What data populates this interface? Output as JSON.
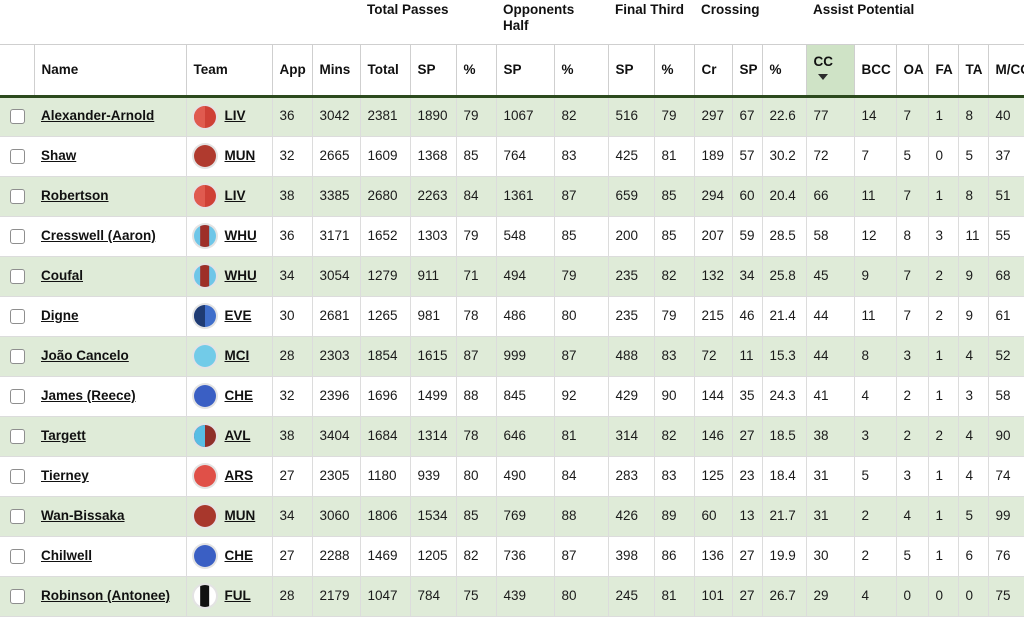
{
  "table": {
    "groups": [
      {
        "label": "",
        "span": 5,
        "blank": true
      },
      {
        "label": "Total Passes",
        "span": 3
      },
      {
        "label": "Opponents Half",
        "span": 2
      },
      {
        "label": "Final Third",
        "span": 2
      },
      {
        "label": "Crossing",
        "span": 3
      },
      {
        "label": "Assist Potential",
        "span": 6
      }
    ],
    "columns": [
      {
        "key": "check",
        "label": "",
        "name": "select-all-column"
      },
      {
        "key": "name",
        "label": "Name",
        "name": "name-column"
      },
      {
        "key": "team",
        "label": "Team",
        "name": "team-column"
      },
      {
        "key": "app",
        "label": "App",
        "name": "app-column"
      },
      {
        "key": "mins",
        "label": "Mins",
        "name": "mins-column"
      },
      {
        "key": "tp_total",
        "label": "Total",
        "name": "total-passes-total-column"
      },
      {
        "key": "tp_sp",
        "label": "SP",
        "name": "total-passes-sp-column"
      },
      {
        "key": "tp_pct",
        "label": "%",
        "name": "total-passes-pct-column"
      },
      {
        "key": "oh_sp",
        "label": "SP",
        "name": "opponents-half-sp-column"
      },
      {
        "key": "oh_pct",
        "label": "%",
        "name": "opponents-half-pct-column"
      },
      {
        "key": "ft_sp",
        "label": "SP",
        "name": "final-third-sp-column"
      },
      {
        "key": "ft_pct",
        "label": "%",
        "name": "final-third-pct-column"
      },
      {
        "key": "cr",
        "label": "Cr",
        "name": "crossing-cr-column"
      },
      {
        "key": "cr_sp",
        "label": "SP",
        "name": "crossing-sp-column"
      },
      {
        "key": "cr_pct",
        "label": "%",
        "name": "crossing-pct-column"
      },
      {
        "key": "cc",
        "label": "CC",
        "name": "assist-cc-column",
        "sorted": true,
        "sort_dir": "desc"
      },
      {
        "key": "bcc",
        "label": "BCC",
        "name": "assist-bcc-column"
      },
      {
        "key": "oa",
        "label": "OA",
        "name": "assist-oa-column"
      },
      {
        "key": "fa",
        "label": "FA",
        "name": "assist-fa-column"
      },
      {
        "key": "ta",
        "label": "TA",
        "name": "assist-ta-column"
      },
      {
        "key": "mcc",
        "label": "M/CC",
        "name": "assist-mcc-column"
      }
    ],
    "sorted_column": "CC",
    "rows": [
      {
        "name": "Alexander-Arnold",
        "team": "LIV",
        "badge": {
          "type": "split",
          "left": "#e05a4f",
          "right": "#cf4036"
        },
        "app": "36",
        "mins": "3042",
        "tp_total": "2381",
        "tp_sp": "1890",
        "tp_pct": "79",
        "oh_sp": "1067",
        "oh_pct": "82",
        "ft_sp": "516",
        "ft_pct": "79",
        "cr": "297",
        "cr_sp": "67",
        "cr_pct": "22.6",
        "cc": "77",
        "bcc": "14",
        "oa": "7",
        "fa": "1",
        "ta": "8",
        "mcc": "40"
      },
      {
        "name": "Shaw",
        "team": "MUN",
        "badge": {
          "type": "solid",
          "left": "#b03a2e",
          "right": "#b03a2e"
        },
        "app": "32",
        "mins": "2665",
        "tp_total": "1609",
        "tp_sp": "1368",
        "tp_pct": "85",
        "oh_sp": "764",
        "oh_pct": "83",
        "ft_sp": "425",
        "ft_pct": "81",
        "cr": "189",
        "cr_sp": "57",
        "cr_pct": "30.2",
        "cc": "72",
        "bcc": "7",
        "oa": "5",
        "fa": "0",
        "ta": "5",
        "mcc": "37"
      },
      {
        "name": "Robertson",
        "team": "LIV",
        "badge": {
          "type": "split",
          "left": "#e05a4f",
          "right": "#cf4036"
        },
        "app": "38",
        "mins": "3385",
        "tp_total": "2680",
        "tp_sp": "2263",
        "tp_pct": "84",
        "oh_sp": "1361",
        "oh_pct": "87",
        "ft_sp": "659",
        "ft_pct": "85",
        "cr": "294",
        "cr_sp": "60",
        "cr_pct": "20.4",
        "cc": "66",
        "bcc": "11",
        "oa": "7",
        "fa": "1",
        "ta": "8",
        "mcc": "51"
      },
      {
        "name": "Cresswell (Aaron)",
        "team": "WHU",
        "badge": {
          "type": "stripe",
          "base": "#6ec6e8",
          "stripe": "#9e2f28"
        },
        "app": "36",
        "mins": "3171",
        "tp_total": "1652",
        "tp_sp": "1303",
        "tp_pct": "79",
        "oh_sp": "548",
        "oh_pct": "85",
        "ft_sp": "200",
        "ft_pct": "85",
        "cr": "207",
        "cr_sp": "59",
        "cr_pct": "28.5",
        "cc": "58",
        "bcc": "12",
        "oa": "8",
        "fa": "3",
        "ta": "11",
        "mcc": "55"
      },
      {
        "name": "Coufal",
        "team": "WHU",
        "badge": {
          "type": "stripe",
          "base": "#6ec6e8",
          "stripe": "#9e2f28"
        },
        "app": "34",
        "mins": "3054",
        "tp_total": "1279",
        "tp_sp": "911",
        "tp_pct": "71",
        "oh_sp": "494",
        "oh_pct": "79",
        "ft_sp": "235",
        "ft_pct": "82",
        "cr": "132",
        "cr_sp": "34",
        "cr_pct": "25.8",
        "cc": "45",
        "bcc": "9",
        "oa": "7",
        "fa": "2",
        "ta": "9",
        "mcc": "68"
      },
      {
        "name": "Digne",
        "team": "EVE",
        "badge": {
          "type": "split",
          "left": "#1f3b73",
          "right": "#3f6ecb"
        },
        "app": "30",
        "mins": "2681",
        "tp_total": "1265",
        "tp_sp": "981",
        "tp_pct": "78",
        "oh_sp": "486",
        "oh_pct": "80",
        "ft_sp": "235",
        "ft_pct": "79",
        "cr": "215",
        "cr_sp": "46",
        "cr_pct": "21.4",
        "cc": "44",
        "bcc": "11",
        "oa": "7",
        "fa": "2",
        "ta": "9",
        "mcc": "61"
      },
      {
        "name": "João Cancelo",
        "team": "MCI",
        "badge": {
          "type": "solid",
          "left": "#72cbe8",
          "right": "#72cbe8"
        },
        "app": "28",
        "mins": "2303",
        "tp_total": "1854",
        "tp_sp": "1615",
        "tp_pct": "87",
        "oh_sp": "999",
        "oh_pct": "87",
        "ft_sp": "488",
        "ft_pct": "83",
        "cr": "72",
        "cr_sp": "11",
        "cr_pct": "15.3",
        "cc": "44",
        "bcc": "8",
        "oa": "3",
        "fa": "1",
        "ta": "4",
        "mcc": "52"
      },
      {
        "name": "James (Reece)",
        "team": "CHE",
        "badge": {
          "type": "solid",
          "left": "#3a5fc4",
          "right": "#3a5fc4"
        },
        "app": "32",
        "mins": "2396",
        "tp_total": "1696",
        "tp_sp": "1499",
        "tp_pct": "88",
        "oh_sp": "845",
        "oh_pct": "92",
        "ft_sp": "429",
        "ft_pct": "90",
        "cr": "144",
        "cr_sp": "35",
        "cr_pct": "24.3",
        "cc": "41",
        "bcc": "4",
        "oa": "2",
        "fa": "1",
        "ta": "3",
        "mcc": "58"
      },
      {
        "name": "Targett",
        "team": "AVL",
        "badge": {
          "type": "split",
          "left": "#58bde4",
          "right": "#8f2f2a"
        },
        "app": "38",
        "mins": "3404",
        "tp_total": "1684",
        "tp_sp": "1314",
        "tp_pct": "78",
        "oh_sp": "646",
        "oh_pct": "81",
        "ft_sp": "314",
        "ft_pct": "82",
        "cr": "146",
        "cr_sp": "27",
        "cr_pct": "18.5",
        "cc": "38",
        "bcc": "3",
        "oa": "2",
        "fa": "2",
        "ta": "4",
        "mcc": "90"
      },
      {
        "name": "Tierney",
        "team": "ARS",
        "badge": {
          "type": "solid",
          "left": "#e05048",
          "right": "#e05048"
        },
        "app": "27",
        "mins": "2305",
        "tp_total": "1180",
        "tp_sp": "939",
        "tp_pct": "80",
        "oh_sp": "490",
        "oh_pct": "84",
        "ft_sp": "283",
        "ft_pct": "83",
        "cr": "125",
        "cr_sp": "23",
        "cr_pct": "18.4",
        "cc": "31",
        "bcc": "5",
        "oa": "3",
        "fa": "1",
        "ta": "4",
        "mcc": "74"
      },
      {
        "name": "Wan-Bissaka",
        "team": "MUN",
        "badge": {
          "type": "solid",
          "left": "#a8372c",
          "right": "#a8372c"
        },
        "app": "34",
        "mins": "3060",
        "tp_total": "1806",
        "tp_sp": "1534",
        "tp_pct": "85",
        "oh_sp": "769",
        "oh_pct": "88",
        "ft_sp": "426",
        "ft_pct": "89",
        "cr": "60",
        "cr_sp": "13",
        "cr_pct": "21.7",
        "cc": "31",
        "bcc": "2",
        "oa": "4",
        "fa": "1",
        "ta": "5",
        "mcc": "99"
      },
      {
        "name": "Chilwell",
        "team": "CHE",
        "badge": {
          "type": "solid",
          "left": "#3a5fc4",
          "right": "#3a5fc4"
        },
        "app": "27",
        "mins": "2288",
        "tp_total": "1469",
        "tp_sp": "1205",
        "tp_pct": "82",
        "oh_sp": "736",
        "oh_pct": "87",
        "ft_sp": "398",
        "ft_pct": "86",
        "cr": "136",
        "cr_sp": "27",
        "cr_pct": "19.9",
        "cc": "30",
        "bcc": "2",
        "oa": "5",
        "fa": "1",
        "ta": "6",
        "mcc": "76"
      },
      {
        "name": "Robinson (Antonee)",
        "team": "FUL",
        "badge": {
          "type": "stripe",
          "base": "#ffffff",
          "stripe": "#111111"
        },
        "app": "28",
        "mins": "2179",
        "tp_total": "1047",
        "tp_sp": "784",
        "tp_pct": "75",
        "oh_sp": "439",
        "oh_pct": "80",
        "ft_sp": "245",
        "ft_pct": "81",
        "cr": "101",
        "cr_sp": "27",
        "cr_pct": "26.7",
        "cc": "29",
        "bcc": "4",
        "oa": "0",
        "fa": "0",
        "ta": "0",
        "mcc": "75"
      }
    ]
  },
  "colors": {
    "row_alt": "#dfebd8",
    "sorted_header": "#cfe3c6",
    "header_rule": "#2c4a1e"
  }
}
